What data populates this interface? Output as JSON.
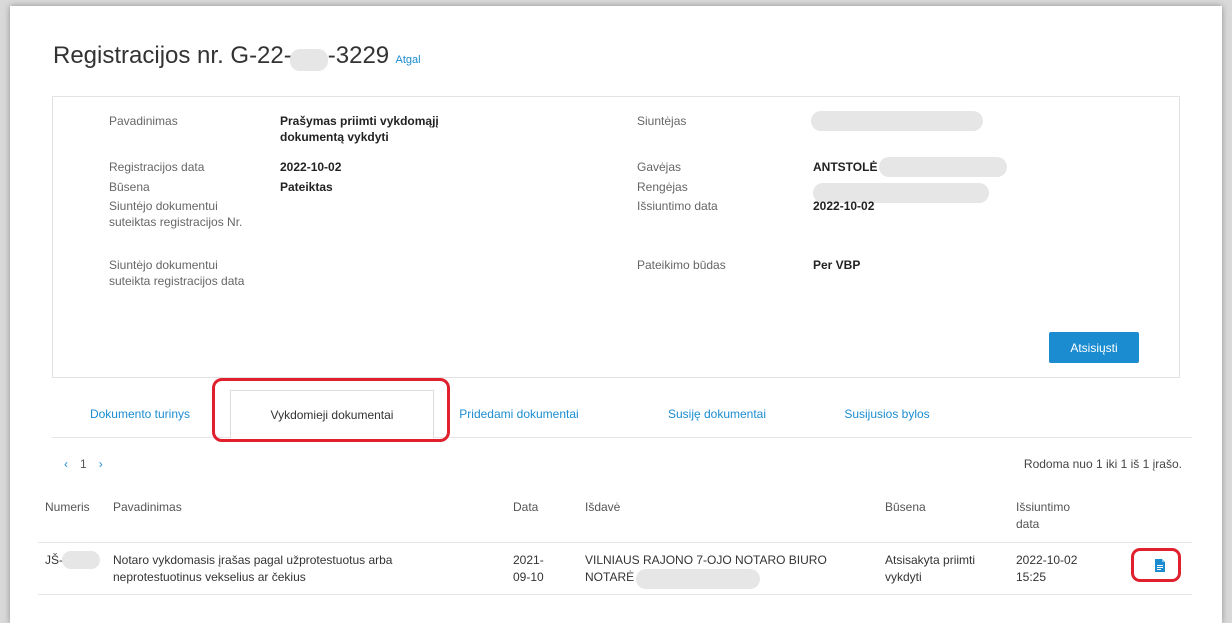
{
  "header": {
    "title": "Registracijos nr. G-22-",
    "title_suffix": "-3229",
    "back_link": "Atgal"
  },
  "details": {
    "left": [
      {
        "label": "Pavadinimas",
        "value": "Prašymas priimti vykdomąjį dokumentą vykdyti"
      },
      {
        "label": "Registracijos data",
        "value": "2022-10-02"
      },
      {
        "label": "Būsena",
        "value": "Pateiktas"
      },
      {
        "label": "Siuntėjo dokumentui suteiktas registracijos Nr.",
        "value": ""
      },
      {
        "label": "Siuntėjo dokumentui suteikta registracijos data",
        "value": ""
      }
    ],
    "right": [
      {
        "label": "Siuntėjas",
        "value": ""
      },
      {
        "label": "Gavėjas",
        "value": "ANTSTOLĖ"
      },
      {
        "label": "Rengėjas",
        "value": ""
      },
      {
        "label": "Išsiuntimo data",
        "value": "2022-10-02"
      },
      {
        "label": "Pateikimo būdas",
        "value": "Per VBP"
      }
    ],
    "download_button": "Atsisiųsti"
  },
  "tabs": [
    {
      "label": "Dokumento turinys",
      "active": false
    },
    {
      "label": "Vykdomieji dokumentai",
      "active": true
    },
    {
      "label": "Pridedami dokumentai",
      "active": false
    },
    {
      "label": "Susiję dokumentai",
      "active": false
    },
    {
      "label": "Susijusios bylos",
      "active": false
    }
  ],
  "pagination": {
    "prev": "‹",
    "page": "1",
    "next": "›",
    "summary": "Rodoma nuo 1 iki 1 iš 1 įrašo."
  },
  "table": {
    "headers": [
      "Numeris",
      "Pavadinimas",
      "Data",
      "Išdavė",
      "Būsena",
      "Išsiuntimo data"
    ],
    "rows": [
      {
        "numeris": "JŠ-",
        "pavadinimas": "Notaro vykdomasis įrašas pagal užprotestuotus arba neprotestuotinus vekselius ar čekius",
        "data": "2021-09-10",
        "isdave": "VILNIAUS RAJONO 7-OJO NOTARO BIURO NOTARĖ",
        "busena": "Atsisakyta priimti vykdyti",
        "issiuntimo_data": "2022-10-02 15:25",
        "icon": "document-icon"
      }
    ]
  },
  "colors": {
    "accent": "#1b8cd0",
    "highlight": "#e0212d",
    "redaction": "#e6e6e6"
  }
}
